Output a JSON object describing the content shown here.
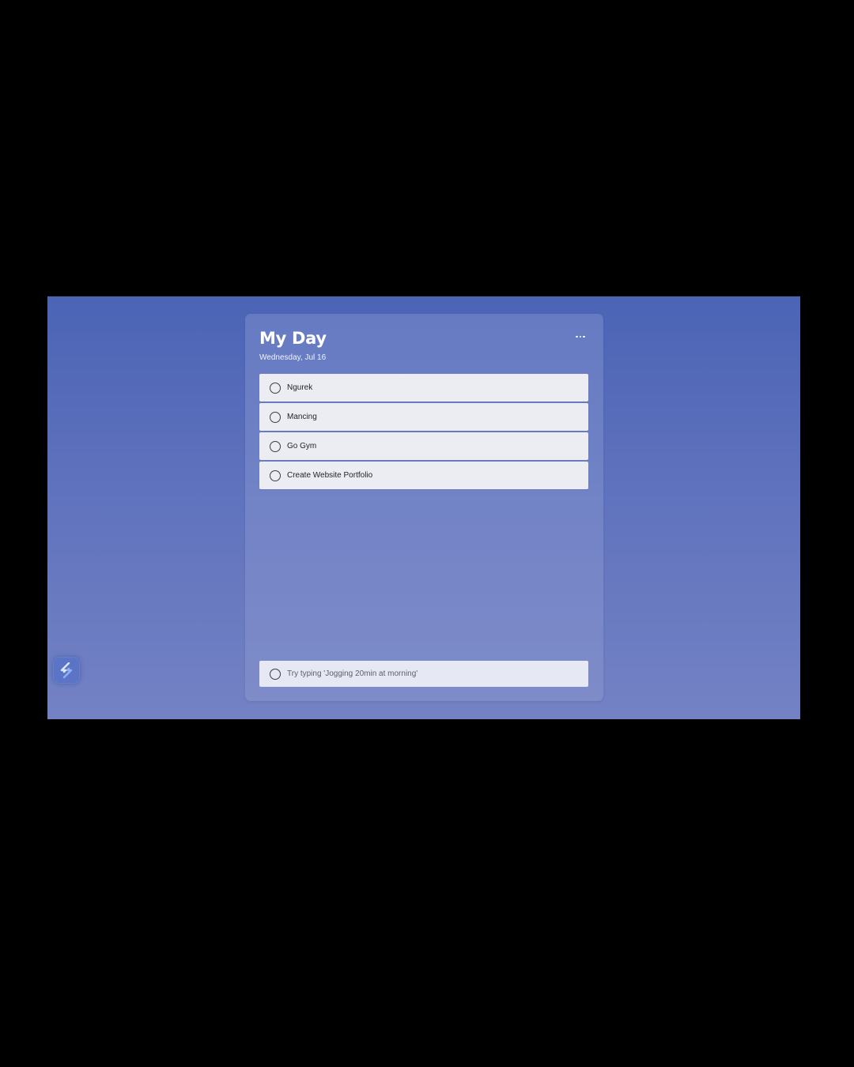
{
  "header": {
    "title": "My Day",
    "date": "Wednesday, Jul 16"
  },
  "tasks": [
    {
      "label": "Ngurek",
      "completed": false
    },
    {
      "label": "Mancing",
      "completed": false
    },
    {
      "label": "Go Gym",
      "completed": false
    },
    {
      "label": "Create Website Portfolio",
      "completed": false
    }
  ],
  "add_task": {
    "placeholder": "Try typing 'Jogging 20min at morning'"
  },
  "icons": {
    "menu": "more-horizontal-icon",
    "task_check": "circle-icon",
    "app": "app-logo-icon"
  },
  "colors": {
    "background_top": "#4b64b5",
    "background_bottom": "#7482c4",
    "task_background": "#ecedf2"
  }
}
